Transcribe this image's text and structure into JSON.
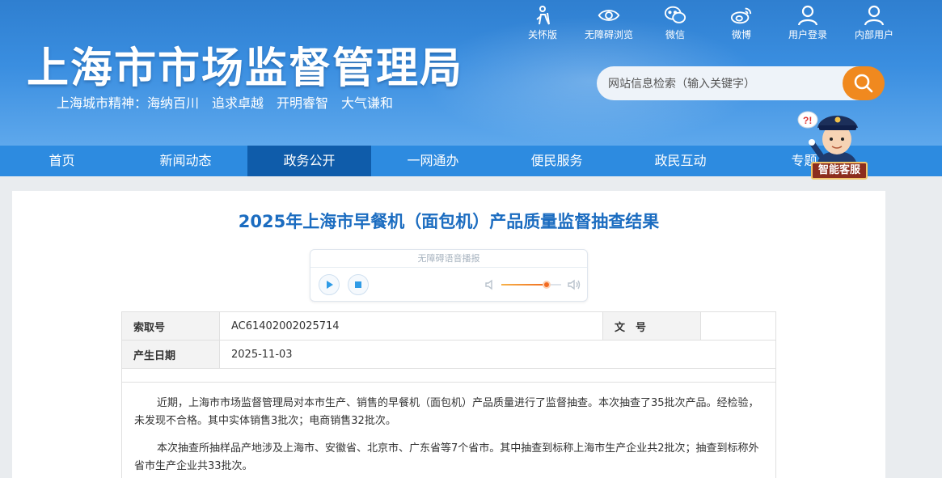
{
  "header": {
    "site_title": "上海市市场监督管理局",
    "slogan": "上海城市精神：海纳百川　追求卓越　开明睿智　大气谦和",
    "top_links": [
      {
        "label": "关怀版",
        "icon": "elderly-care-icon"
      },
      {
        "label": "无障碍浏览",
        "icon": "eye-icon"
      },
      {
        "label": "微信",
        "icon": "wechat-icon"
      },
      {
        "label": "微博",
        "icon": "weibo-icon"
      },
      {
        "label": "用户登录",
        "icon": "user-icon"
      },
      {
        "label": "内部用户",
        "icon": "user-icon"
      }
    ],
    "search": {
      "placeholder": "网站信息检索（输入关键字）",
      "icon": "search-icon"
    },
    "kefu_label": "智能客服"
  },
  "nav": {
    "items": [
      {
        "label": "首页"
      },
      {
        "label": "新闻动态"
      },
      {
        "label": "政务公开",
        "active": true
      },
      {
        "label": "一网通办"
      },
      {
        "label": "便民服务"
      },
      {
        "label": "政民互动"
      },
      {
        "label": "专题"
      }
    ]
  },
  "article": {
    "title": "2025年上海市早餐机（面包机）产品质量监督抽查结果",
    "player": {
      "title": "无障碍语音播报",
      "volume": 0.75
    },
    "meta": {
      "index_label": "索取号",
      "index_value": "AC61402002025714",
      "doc_no_label": "文　号",
      "doc_no_value": "",
      "date_label": "产生日期",
      "date_value": "2025-11-03"
    },
    "paragraphs": [
      "近期，上海市市场监督管理局对本市生产、销售的早餐机（面包机）产品质量进行了监督抽查。本次抽查了35批次产品。经检验，未发现不合格。其中实体销售3批次；电商销售32批次。",
      "本次抽查所抽样品产地涉及上海市、安徽省、北京市、广东省等7个省市。其中抽查到标称上海市生产企业共2批次；抽查到标称外省市生产企业共33批次。"
    ]
  },
  "colors": {
    "nav_bg": "#2d8be0",
    "nav_active": "#0f5caa",
    "title_blue": "#1b6cc0",
    "search_btn": "#f0891f"
  }
}
